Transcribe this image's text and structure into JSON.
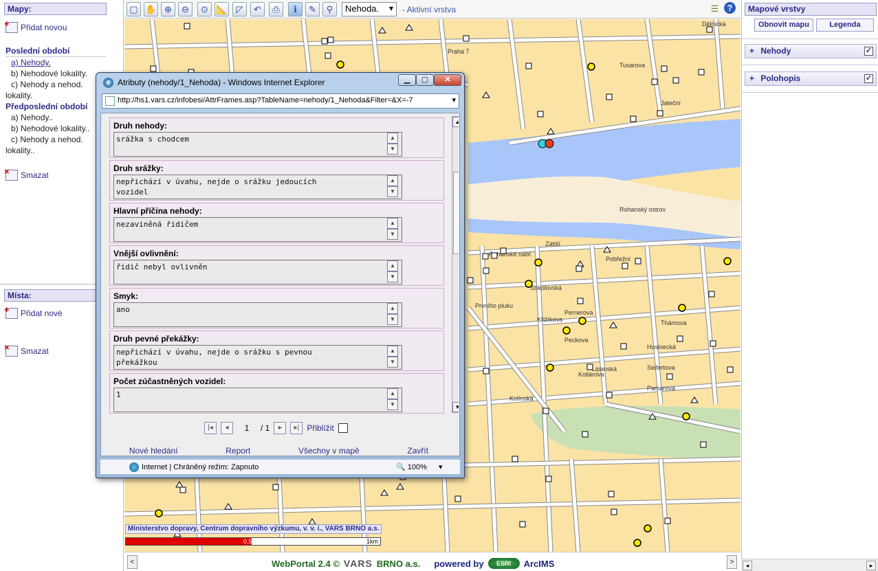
{
  "left": {
    "maps_header": "Mapy:",
    "add_new_map": "Přidat novou",
    "last_period_title": "Poslední období",
    "last_period_items": [
      "a) Nehody.",
      "b) Nehodové lokality.",
      "c) Nehody a nehod.",
      "lokality."
    ],
    "prev_period_title": "Předposlední období",
    "prev_period_items": [
      "a) Nehody..",
      "b) Nehodové lokality..",
      "c) Nehody a nehod.",
      "lokality.."
    ],
    "delete_map": "Smazat",
    "places_header": "Místa:",
    "add_new_place": "Přidat nové",
    "delete_place": "Smazat"
  },
  "toolbar": {
    "icons": [
      "full-extent-icon",
      "pan-icon",
      "zoom-in-icon",
      "zoom-out-icon",
      "zoom-previous-icon",
      "measure-icon",
      "select-area-icon",
      "undo-icon",
      "print-icon",
      "identify-icon",
      "clear-selection-icon",
      "hand-icon"
    ],
    "layer_select_value": "Nehoda.",
    "active_layer_label": "- Aktivní vrstva"
  },
  "map": {
    "attribution": "Ministerstvo dopravy, Centrum dopravního výzkumu, v. v. i., VARS BRNO a.s.",
    "scale_label_mid": "0,5",
    "scale_label_end": "1km",
    "street_labels": [
      "Praha 7",
      "Rohanský ostrov",
      "Zátiší",
      "Pobřežní",
      "Sokolovská",
      "Pernerova",
      "Křižíkova",
      "Thámova",
      "Husinecká",
      "Lipanská",
      "Seifertova",
      "Kollárova",
      "Pamarova",
      "Jateční",
      "Tusarova",
      "Dělnická",
      "Rohanské nábř.",
      "Prvního pluku",
      "Peckova",
      "Kolínská"
    ],
    "colors": {
      "land": "#fbe3a6",
      "water": "#a9c6fb",
      "sand": "#f8eed8",
      "park": "#c9e0b4",
      "road": "#ffffff",
      "outline": "#888888"
    }
  },
  "footer": {
    "brand": "WebPortal 2.4 ©",
    "vars": "VARS",
    "company": "BRNO a.s.",
    "powered_by": "powered by",
    "esri": "ESRI",
    "arcims": "ArcIMS"
  },
  "right": {
    "header": "Mapové vrstvy",
    "refresh_button": "Obnovit mapu",
    "legend_button": "Legenda",
    "layers": [
      {
        "name": "Nehody",
        "checked": true
      },
      {
        "name": "Polohopis",
        "checked": true
      }
    ]
  },
  "popup": {
    "title": "Atributy (nehody/1_Nehoda) - Windows Internet Explorer",
    "address": "http://hs1.vars.cz/infobesi/AttrFrames.asp?TableName=nehody/1_Nehoda&Filter=&X=-7",
    "fields": [
      {
        "label": "Druh nehody:",
        "value": "srážka s chodcem"
      },
      {
        "label": "Druh srážky:",
        "value": "nepřichází v úvahu, nejde o srážku jedoucích\nvozidel"
      },
      {
        "label": "Hlavní příčina nehody:",
        "value": "nezaviněná řidičem"
      },
      {
        "label": "Vnější ovlivnění:",
        "value": "řidič nebyl ovlivněn"
      },
      {
        "label": "Smyk:",
        "value": "ano"
      },
      {
        "label": "Druh pevné překážky:",
        "value": "nepřichází v úvahu, nejde o srážku s pevnou\npřekážkou"
      },
      {
        "label": "Počet zúčastněných vozidel:",
        "value": "1"
      }
    ],
    "pager": {
      "current": "1",
      "total": "/ 1",
      "zoom_label": "Přiblížit"
    },
    "actions": [
      "Nové hledání",
      "Report",
      "Všechny v mapě",
      "Zavřít"
    ],
    "status_zone": "Internet | Chráněný režim: Zapnuto",
    "status_zoom": "100%"
  }
}
